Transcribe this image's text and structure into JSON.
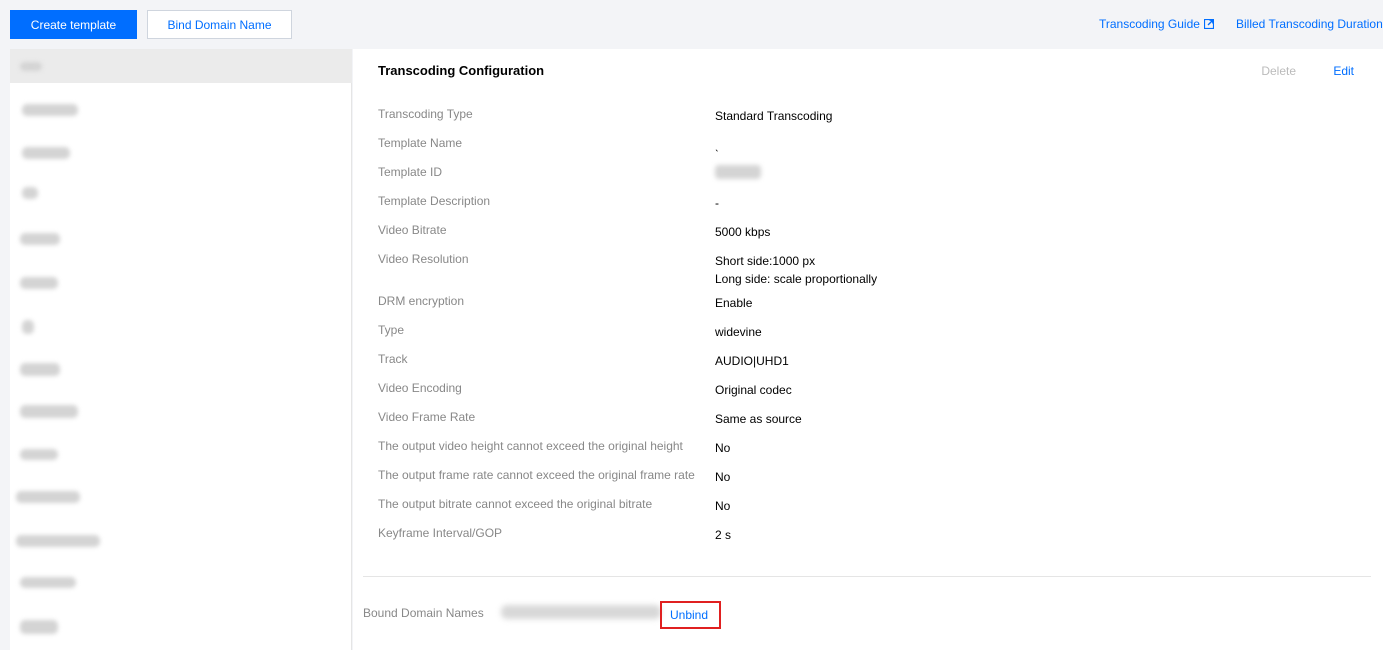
{
  "toolbar": {
    "create_label": "Create template",
    "bind_label": "Bind Domain Name",
    "guide_link": "Transcoding Guide",
    "billed_link": "Billed Transcoding Duration"
  },
  "detail": {
    "title": "Transcoding Configuration",
    "delete_label": "Delete",
    "edit_label": "Edit",
    "rows": [
      {
        "key": "Transcoding Type",
        "value": "Standard Transcoding"
      },
      {
        "key": "Template Name",
        "value": "ˎ"
      },
      {
        "key": "Template ID",
        "value": ""
      },
      {
        "key": "Template Description",
        "value": "-"
      },
      {
        "key": "Video Bitrate",
        "value": "5000 kbps"
      },
      {
        "key": "Video Resolution",
        "value": "Short side:1000 px",
        "value2": "Long side: scale proportionally"
      },
      {
        "key": "DRM encryption",
        "value": "Enable"
      },
      {
        "key": "Type",
        "value": "widevine"
      },
      {
        "key": "Track",
        "value": "AUDIO|UHD1"
      },
      {
        "key": "Video Encoding",
        "value": "Original codec"
      },
      {
        "key": "Video Frame Rate",
        "value": "Same as source"
      },
      {
        "key": "The output video height cannot exceed the original height",
        "value": "No"
      },
      {
        "key": "The output frame rate cannot exceed the original frame rate",
        "value": "No"
      },
      {
        "key": "The output bitrate cannot exceed the original bitrate",
        "value": "No"
      },
      {
        "key": "Keyframe Interval/GOP",
        "value": "2  s"
      }
    ],
    "bound_label": "Bound Domain Names",
    "unbind_label": "Unbind"
  },
  "icons": {
    "external_link": "external-link-icon"
  },
  "colors": {
    "accent": "#006eff",
    "highlight": "#e02020"
  }
}
